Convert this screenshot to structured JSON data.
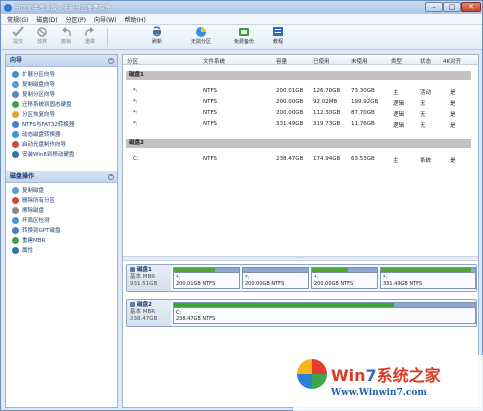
{
  "window": {
    "title": "分区助手专业版 - 无损分区免费软件",
    "min": "–",
    "max": "□",
    "close": "✕"
  },
  "menu": [
    "常规(G)",
    "磁盘(D)",
    "分区(P)",
    "向导(W)",
    "帮助(H)"
  ],
  "toolbar": [
    {
      "label": "提交",
      "icon": "check-icon",
      "dim": true
    },
    {
      "label": "放弃",
      "icon": "discard-icon",
      "dim": true
    },
    {
      "label": "撤销",
      "icon": "undo-icon",
      "dim": true
    },
    {
      "label": "重做",
      "icon": "redo-icon",
      "dim": true
    },
    {
      "label": "刷新",
      "icon": "refresh-icon",
      "dim": false
    },
    {
      "label": "无损分区",
      "icon": "partition-icon",
      "dim": false
    },
    {
      "label": "免费备份",
      "icon": "backup-icon",
      "dim": false
    },
    {
      "label": "教程",
      "icon": "tutorial-icon",
      "dim": false
    }
  ],
  "wizard": {
    "title": "向导",
    "items": [
      "扩展分区向导",
      "复制磁盘向导",
      "复制分区向导",
      "迁移系统到固态硬盘",
      "分区恢复向导",
      "NTFS与FAT32转换器",
      "动态磁盘转换器",
      "启动光盘制作向导",
      "安装Win8到移动硬盘"
    ]
  },
  "disk_ops": {
    "title": "磁盘操作",
    "items": [
      "复制磁盘",
      "删除所有分区",
      "擦除磁盘",
      "坏扇区检测",
      "转换到GPT磁盘",
      "重建MBR",
      "属性"
    ]
  },
  "columns": [
    "分区",
    "文件系统",
    "容量",
    "已使用",
    "未使用",
    "类型",
    "状态",
    "4K对齐"
  ],
  "disks": [
    {
      "name": "磁盘1",
      "rows": [
        [
          "*:",
          "NTFS",
          "200.01GB",
          "126.70GB",
          "73.30GB",
          "主",
          "活动",
          "是"
        ],
        [
          "*:",
          "NTFS",
          "200.00GB",
          "92.02MB",
          "199.92GB",
          "逻辑",
          "无",
          "是"
        ],
        [
          "*:",
          "NTFS",
          "200.00GB",
          "112.30GB",
          "87.70GB",
          "逻辑",
          "无",
          "是"
        ],
        [
          "*:",
          "NTFS",
          "331.49GB",
          "319.73GB",
          "11.76GB",
          "逻辑",
          "无",
          "是"
        ]
      ]
    },
    {
      "name": "磁盘2",
      "rows": [
        [
          "C:",
          "NTFS",
          "238.47GB",
          "174.94GB",
          "63.53GB",
          "主",
          "系统",
          "是"
        ]
      ]
    }
  ],
  "disk_maps": [
    {
      "name": "磁盘1",
      "kind": "基本 MBR",
      "size": "931.51GB",
      "parts": [
        {
          "label": "*:",
          "info": "200.01GB NTFS",
          "used": 0.63
        },
        {
          "label": "*:",
          "info": "200.00GB NTFS",
          "used": 0.0
        },
        {
          "label": "*:",
          "info": "200.00GB NTFS",
          "used": 0.56
        },
        {
          "label": "*:",
          "info": "331.49GB NTFS",
          "used": 0.96
        }
      ]
    },
    {
      "name": "磁盘2",
      "kind": "基本 MBR",
      "size": "238.47GB",
      "parts": [
        {
          "label": "C:",
          "info": "238.47GB NTFS",
          "used": 0.73
        }
      ]
    }
  ],
  "watermark": {
    "brand_a": "Win",
    "brand_7": "7",
    "brand_b": "系统之家",
    "url": "Www.Winwin7.com"
  },
  "colors": {
    "used_fill": "#4ea838",
    "used_fill_c": "#3aa335",
    "part_bar": "#8ea5d0"
  }
}
